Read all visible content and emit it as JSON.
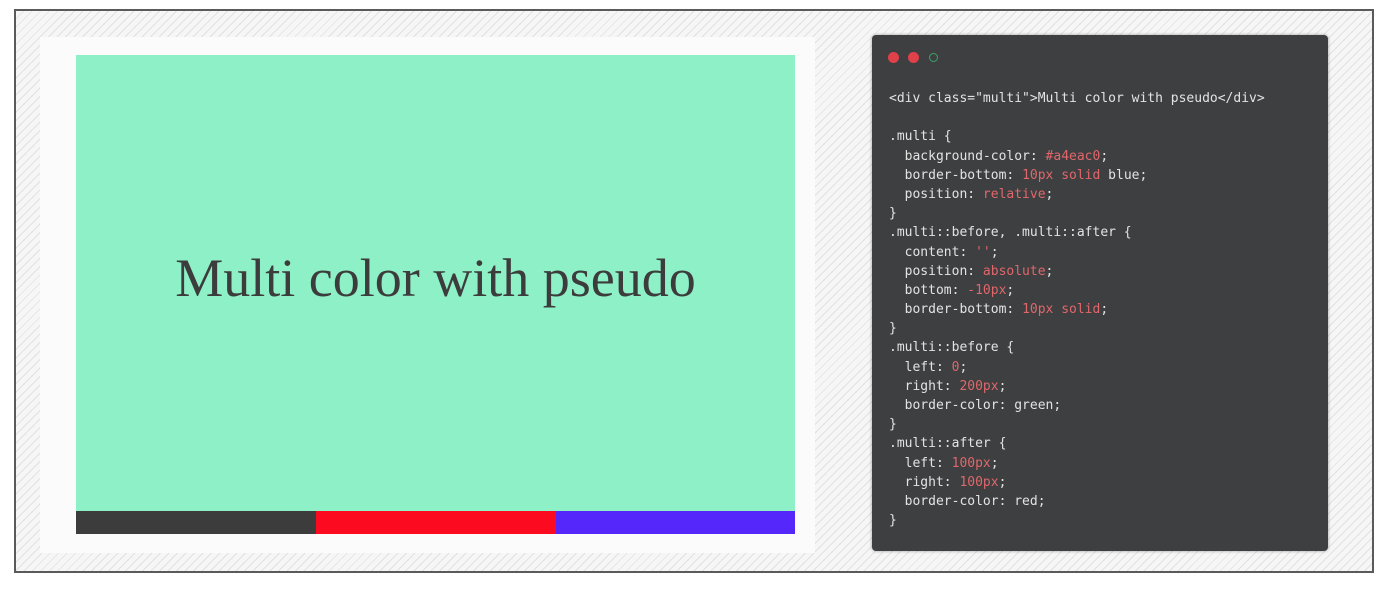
{
  "colors": {
    "demo_background": "#8df0c6",
    "bar_1": "#3c3c3c",
    "bar_2": "#fc0a1f",
    "bar_3": "#5627fa",
    "editor_background": "#3e3f40",
    "code_text": "#e3e3e3",
    "code_value": "#e0676c",
    "window_dot_red": "#e0404a",
    "window_dot_outline": "#3aa36a"
  },
  "preview": {
    "text": "Multi color with pseudo",
    "bar_segments": [
      "dark",
      "red",
      "blue"
    ]
  },
  "editor": {
    "window_controls": [
      "close-icon",
      "minimize-icon",
      "maximize-icon"
    ],
    "lines": [
      [
        {
          "t": "<div class=\"multi\">Multi color with pseudo</div>"
        }
      ],
      [
        {
          "t": ""
        }
      ],
      [
        {
          "t": ".multi {"
        }
      ],
      [
        {
          "t": "  background-color: "
        },
        {
          "t": "#a4eac0",
          "v": true
        },
        {
          "t": ";"
        }
      ],
      [
        {
          "t": "  border-bottom: "
        },
        {
          "t": "10px solid",
          "v": true
        },
        {
          "t": " blue;"
        }
      ],
      [
        {
          "t": "  position: "
        },
        {
          "t": "relative",
          "v": true
        },
        {
          "t": ";"
        }
      ],
      [
        {
          "t": "}"
        }
      ],
      [
        {
          "t": ".multi::before, .multi::after {"
        }
      ],
      [
        {
          "t": "  content: "
        },
        {
          "t": "''",
          "v": true
        },
        {
          "t": ";"
        }
      ],
      [
        {
          "t": "  position: "
        },
        {
          "t": "absolute",
          "v": true
        },
        {
          "t": ";"
        }
      ],
      [
        {
          "t": "  bottom: "
        },
        {
          "t": "-10px",
          "v": true
        },
        {
          "t": ";"
        }
      ],
      [
        {
          "t": "  border-bottom: "
        },
        {
          "t": "10px solid",
          "v": true
        },
        {
          "t": ";"
        }
      ],
      [
        {
          "t": "}"
        }
      ],
      [
        {
          "t": ".multi::before {"
        }
      ],
      [
        {
          "t": "  left: "
        },
        {
          "t": "0",
          "v": true
        },
        {
          "t": ";"
        }
      ],
      [
        {
          "t": "  right: "
        },
        {
          "t": "200px",
          "v": true
        },
        {
          "t": ";"
        }
      ],
      [
        {
          "t": "  border-color: green;"
        }
      ],
      [
        {
          "t": "}"
        }
      ],
      [
        {
          "t": ".multi::after {"
        }
      ],
      [
        {
          "t": "  left: "
        },
        {
          "t": "100px",
          "v": true
        },
        {
          "t": ";"
        }
      ],
      [
        {
          "t": "  right: "
        },
        {
          "t": "100px",
          "v": true
        },
        {
          "t": ";"
        }
      ],
      [
        {
          "t": "  border-color: red;"
        }
      ],
      [
        {
          "t": "}"
        }
      ]
    ]
  }
}
